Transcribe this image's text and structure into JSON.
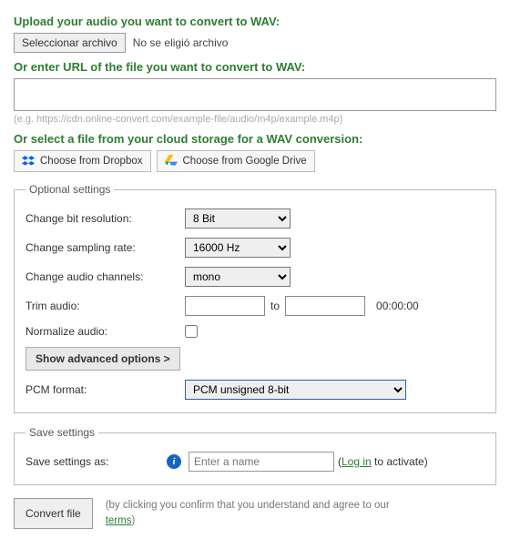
{
  "headings": {
    "upload": "Upload your audio you want to convert to WAV:",
    "url": "Or enter URL of the file you want to convert to WAV:",
    "cloud": "Or select a file from your cloud storage for a WAV conversion:"
  },
  "file": {
    "button": "Seleccionar archivo",
    "status": "No se eligió archivo"
  },
  "url_hint": "(e.g. https://cdn.online-convert.com/example-file/audio/m4p/example.m4p)",
  "cloud": {
    "dropbox": "Choose from Dropbox",
    "gdrive": "Choose from Google Drive"
  },
  "optional": {
    "legend": "Optional settings",
    "bit_label": "Change bit resolution:",
    "bit_value": "8 Bit",
    "rate_label": "Change sampling rate:",
    "rate_value": "16000 Hz",
    "channels_label": "Change audio channels:",
    "channels_value": "mono",
    "trim_label": "Trim audio:",
    "trim_sep": "to",
    "trim_dur": "00:00:00",
    "normalize_label": "Normalize audio:",
    "advanced": "Show advanced options >",
    "pcm_label": "PCM format:",
    "pcm_value": "PCM unsigned 8-bit"
  },
  "save": {
    "legend": "Save settings",
    "label": "Save settings as:",
    "placeholder": "Enter a name",
    "login": "Log in",
    "login_suffix": " to activate)"
  },
  "convert": {
    "button": "Convert file",
    "disclaimer_pre": "(by clicking you confirm that you understand and agree to our ",
    "terms": "terms",
    "disclaimer_post": ")"
  }
}
